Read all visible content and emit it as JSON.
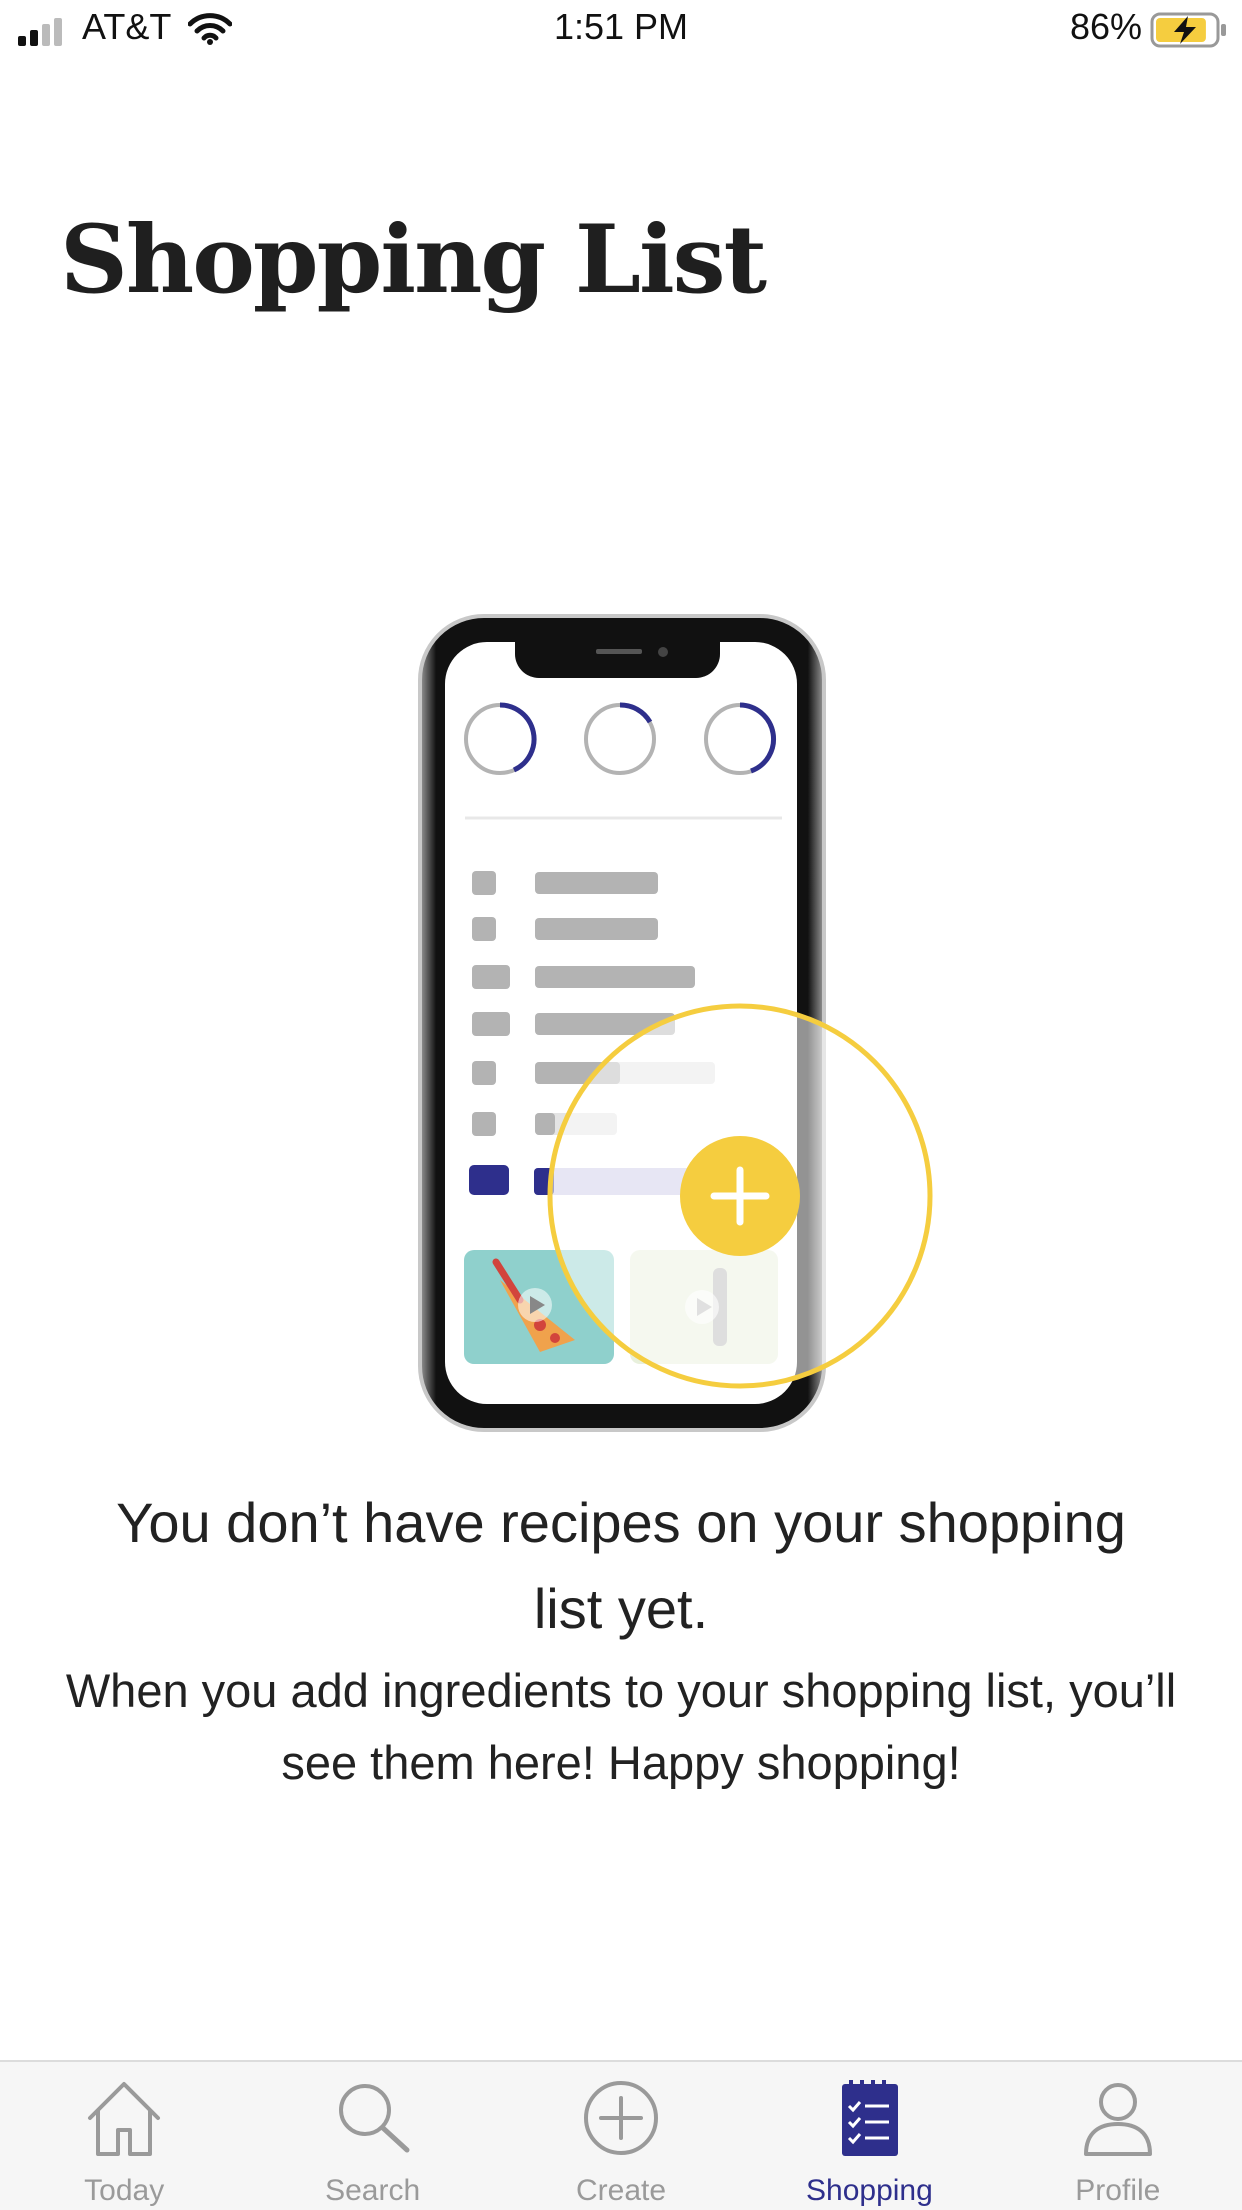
{
  "status_bar": {
    "carrier": "AT&T",
    "time": "1:51 PM",
    "battery_percent": "86%",
    "battery_level": 0.86,
    "battery_charging": true
  },
  "page": {
    "title": "Shopping List"
  },
  "empty_state": {
    "heading": "You don’t have recipes on your shopping list yet.",
    "body": "When you add ingredients to your shopping list, you’ll see them here! Happy shopping!"
  },
  "tab_bar": {
    "active": "Shopping",
    "tabs": [
      {
        "label": "Today",
        "icon": "home-icon"
      },
      {
        "label": "Search",
        "icon": "search-icon"
      },
      {
        "label": "Create",
        "icon": "plus-circle-icon"
      },
      {
        "label": "Shopping",
        "icon": "shopping-list-icon"
      },
      {
        "label": "Profile",
        "icon": "person-icon"
      }
    ]
  },
  "colors": {
    "accent": "#2e2f8c",
    "highlight": "#f5cd3f",
    "inactive": "#9a9a9a"
  }
}
